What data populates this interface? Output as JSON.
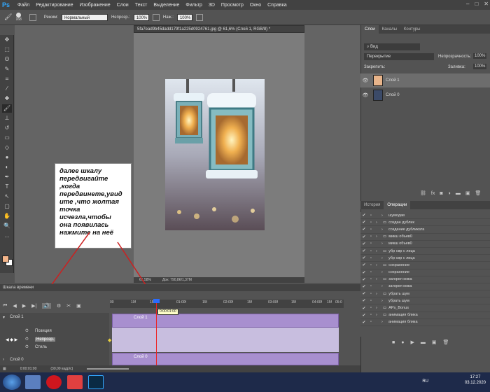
{
  "menubar": {
    "logo": "Ps",
    "items": [
      "Файл",
      "Редактирование",
      "Изображение",
      "Слои",
      "Текст",
      "Выделение",
      "Фильтр",
      "3D",
      "Просмотр",
      "Окно",
      "Справка"
    ]
  },
  "options": {
    "brush_size": "168",
    "mode_label": "Режим:",
    "mode_value": "Нормальный",
    "opacity_label": "Непрозр.:",
    "opacity_value": "100%",
    "pressure_label": "Наж.:",
    "pressure_value": "100%"
  },
  "document": {
    "tab_title": "5fa7ead9b45dadd179f1a225d0924761.jpg @ 61,6% (Слой 1, RGB/8) *",
    "zoom": "61,58%",
    "doc_size": "Док: 790,8К/1,37М"
  },
  "annotation": {
    "text": "далее  шкалу\nпередвигайте\n,когда\nпередвинете,увид\nите ,что  жолтая\nточка\nисчезла,чтобы\nона появилась\nнажмите на неё",
    "arrow_color": "#cc2020"
  },
  "timeline": {
    "title": "Шкала времени",
    "ticks": [
      "00",
      "10f",
      "15f",
      "01:00f",
      "15f",
      "02:00f",
      "15f",
      "03:00f",
      "15f",
      "04:00f",
      "15f",
      "05:0"
    ],
    "time_tip": "0:00:01:00",
    "layer_top": "Слой 1",
    "row_position": "Позиция",
    "row_opacity": "Непрозр.",
    "row_style": "Стиль",
    "layer_bottom": "Слой 0",
    "clip_top_label": "Слой 1",
    "clip_bottom_label": "Слой 0",
    "current_time": "0:00:01:00",
    "fps": "(30,00 кадр/с)"
  },
  "layers_panel": {
    "tabs": [
      "Слои",
      "Каналы",
      "Контуры"
    ],
    "filter": "Вид",
    "blend": "Перекрытие",
    "opacity_label": "Непрозрачность:",
    "opacity": "100%",
    "lock_label": "Закрепить:",
    "fill_label": "Заливка:",
    "fill": "100%",
    "layers": [
      {
        "name": "Слой 1",
        "selected": true
      },
      {
        "name": "Слой 0",
        "selected": false
      }
    ]
  },
  "actions_panel": {
    "tabs": [
      "История",
      "Операции"
    ],
    "items": [
      {
        "label": "шумодав",
        "folder": false,
        "arrow": true
      },
      {
        "label": "создан дублик",
        "folder": true,
        "arrow": true
      },
      {
        "label": "создание дубликата",
        "folder": false,
        "arrow": true
      },
      {
        "label": "микш объев0",
        "folder": true,
        "arrow": true
      },
      {
        "label": "микш объев0",
        "folder": false,
        "arrow": true
      },
      {
        "label": "убр свр с лица",
        "folder": true,
        "arrow": true
      },
      {
        "label": "убр свр с лица",
        "folder": false,
        "arrow": true
      },
      {
        "label": "сохранение",
        "folder": true,
        "arrow": true
      },
      {
        "label": "сохранение",
        "folder": false,
        "arrow": true
      },
      {
        "label": "загорел кожа",
        "folder": true,
        "arrow": true
      },
      {
        "label": "загорел кожа",
        "folder": false,
        "arrow": true
      },
      {
        "label": "убрать шум",
        "folder": true,
        "arrow": true
      },
      {
        "label": "убрать шум",
        "folder": false,
        "arrow": true
      },
      {
        "label": "APs_Bonus",
        "folder": true,
        "arrow": true
      },
      {
        "label": "анимация блика",
        "folder": true,
        "arrow": true
      },
      {
        "label": "анимация блика",
        "folder": false,
        "arrow": true
      }
    ]
  },
  "taskbar": {
    "lang": "RU",
    "time": "17:27",
    "date": "03.12.2020"
  }
}
